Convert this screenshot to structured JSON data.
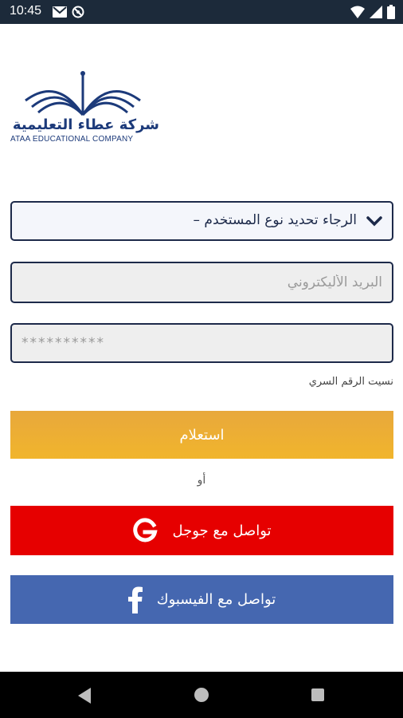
{
  "status_bar": {
    "time": "10:45"
  },
  "logo": {
    "arabic_name": "شركة عطاء التعليمية",
    "english_name": "ATAA EDUCATIONAL COMPANY"
  },
  "form": {
    "user_type_select": "الرجاء تحديد نوع المستخدم –",
    "email_placeholder": "البريد الأليكتروني",
    "password_value": "**********",
    "forgot_password": "نسيت الرقم السري"
  },
  "buttons": {
    "login": "استعلام",
    "or": "أو",
    "google": "تواصل مع جوجل",
    "facebook": "تواصل مع الفيسبوك"
  },
  "colors": {
    "login_button": "#f0b030",
    "google_button": "#e60000",
    "facebook_button": "#4567b0",
    "status_bar": "#1c2a3a"
  },
  "icons": {
    "status": [
      "gmail-icon",
      "no-disturb-icon",
      "wifi-icon",
      "signal-icon",
      "battery-icon"
    ],
    "select": "chevron-down-icon",
    "google": "google-g-icon",
    "facebook": "facebook-f-icon",
    "nav": [
      "back-icon",
      "home-icon",
      "recents-icon"
    ]
  }
}
